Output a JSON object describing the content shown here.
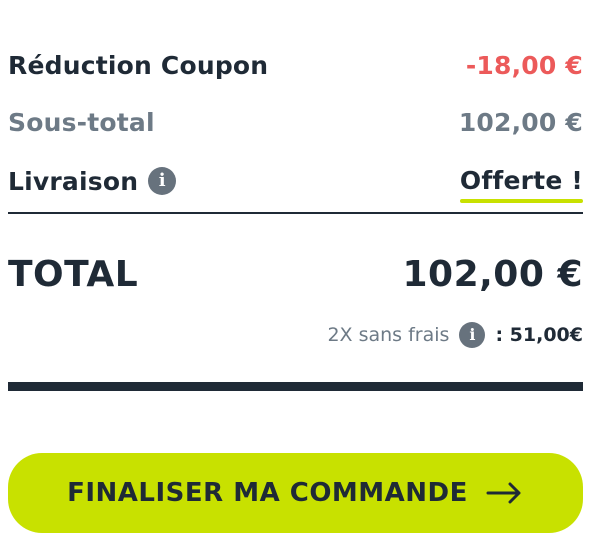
{
  "summary": {
    "coupon": {
      "label": "Réduction Coupon",
      "value": "-18,00 €"
    },
    "subtotal": {
      "label": "Sous-total",
      "value": "102,00 €"
    },
    "delivery": {
      "label": "Livraison",
      "value": "Offerte !",
      "info_icon": "info-icon",
      "info_icon_glyph": "i"
    },
    "total": {
      "label": "TOTAL",
      "value": "102,00 €"
    },
    "installment": {
      "label": "2X sans frais",
      "value": ": 51,00€",
      "info_icon": "info-icon",
      "info_icon_glyph": "i"
    }
  },
  "checkout_button": {
    "label": "FINALISER MA COMMANDE",
    "icon": "arrow-right-icon"
  },
  "colors": {
    "text": "#1f2a36",
    "muted_text": "#6d7a86",
    "discount": "#ec5a5a",
    "accent": "#c8e100",
    "divider": "#1f2a36",
    "info_icon": "#67727d",
    "background": "#ffffff"
  }
}
